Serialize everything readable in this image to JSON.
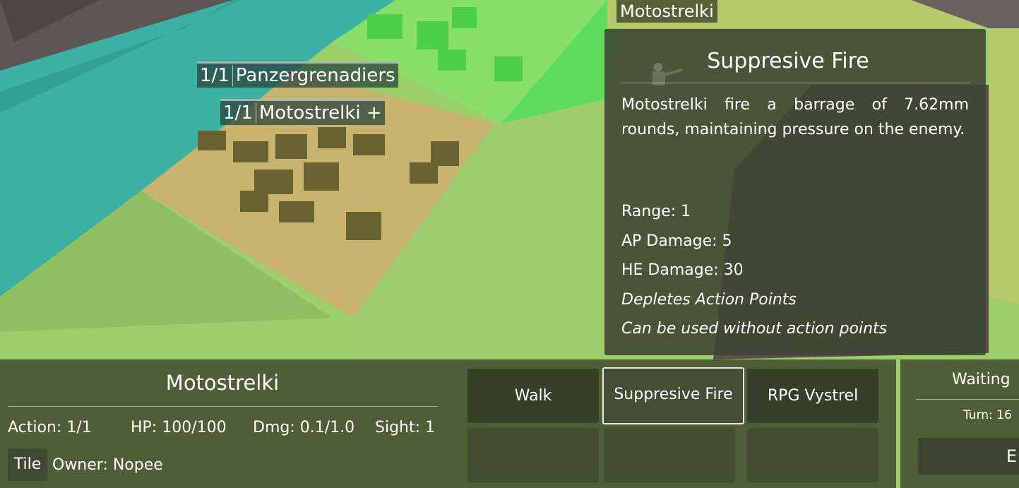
{
  "scene": {
    "colors": {
      "water": "#3fb3a5",
      "grass": "#9ccf6a",
      "field_yellow": "#c8b870",
      "forest_green": "#5fdc5c",
      "rock": "#5a5250"
    }
  },
  "map_labels": {
    "panzer": {
      "count": "1/1",
      "name": "Panzergrenadiers"
    },
    "moto": {
      "count": "1/1",
      "name": "Motostrelki +"
    },
    "top_unit": "Motostrelki"
  },
  "tooltip": {
    "title": "Suppresive Fire",
    "description": "Motostrelki fire a barrage of 7.62mm rounds, maintaining pressure on the enemy.",
    "range": "Range: 1",
    "ap_damage": "AP Damage: 5",
    "he_damage": "HE Damage: 30",
    "note1": "Depletes Action Points",
    "note2": "Can be used without action points"
  },
  "unit_panel": {
    "name": "Motostrelki",
    "action": "Action: 1/1",
    "hp": "HP: 100/100",
    "dmg": "Dmg: 0.1/1.0",
    "sight": "Sight: 1",
    "tile_button": "Tile",
    "owner": "Owner: Nopee"
  },
  "actions": [
    {
      "label": "Walk",
      "selected": false
    },
    {
      "label": "Suppresive Fire",
      "selected": true
    },
    {
      "label": "RPG Vystrel",
      "selected": false
    },
    {
      "label": "",
      "selected": false
    },
    {
      "label": "",
      "selected": false
    },
    {
      "label": "",
      "selected": false
    }
  ],
  "turn_panel": {
    "status": "Waiting",
    "turn": "Turn: 16",
    "end_button": "E"
  }
}
